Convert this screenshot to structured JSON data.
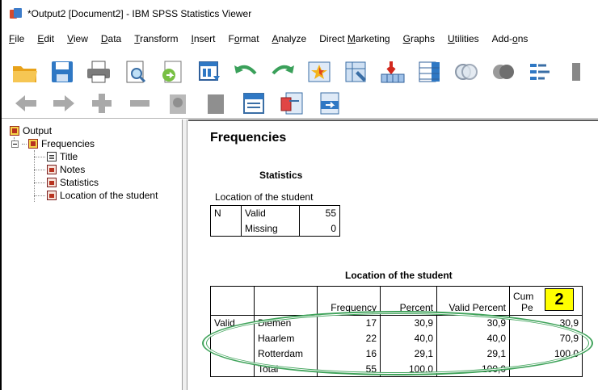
{
  "window": {
    "title": "*Output2 [Document2] - IBM SPSS Statistics Viewer"
  },
  "menu": [
    {
      "label": "File",
      "key": "F"
    },
    {
      "label": "Edit",
      "key": "E"
    },
    {
      "label": "View",
      "key": "V"
    },
    {
      "label": "Data",
      "key": "D"
    },
    {
      "label": "Transform",
      "key": "T"
    },
    {
      "label": "Insert",
      "key": "I"
    },
    {
      "label": "Format",
      "key": "o"
    },
    {
      "label": "Analyze",
      "key": "A"
    },
    {
      "label": "Direct Marketing",
      "key": "M"
    },
    {
      "label": "Graphs",
      "key": "G"
    },
    {
      "label": "Utilities",
      "key": "U"
    },
    {
      "label": "Add-ons",
      "key": "o"
    }
  ],
  "tree": {
    "root": "Output",
    "group": "Frequencies",
    "items": [
      "Title",
      "Notes",
      "Statistics",
      "Location of the student"
    ]
  },
  "output": {
    "heading": "Frequencies",
    "statistics": {
      "title": "Statistics",
      "variable": "Location of the student",
      "n_label": "N",
      "rows": [
        {
          "label": "Valid",
          "value": "55"
        },
        {
          "label": "Missing",
          "value": "0"
        }
      ]
    },
    "frequency": {
      "title": "Location of the student",
      "headers": {
        "frequency": "Frequency",
        "percent": "Percent",
        "valid_percent": "Valid Percent",
        "cumulative_line1": "Cum",
        "cumulative_line2": "Pe"
      },
      "valid_label": "Valid",
      "rows": [
        {
          "name": "Diemen",
          "frequency": "17",
          "percent": "30,9",
          "valid_percent": "30,9",
          "cumulative": "30,9"
        },
        {
          "name": "Haarlem",
          "frequency": "22",
          "percent": "40,0",
          "valid_percent": "40,0",
          "cumulative": "70,9"
        },
        {
          "name": "Rotterdam",
          "frequency": "16",
          "percent": "29,1",
          "valid_percent": "29,1",
          "cumulative": "100,0"
        },
        {
          "name": "Total",
          "frequency": "55",
          "percent": "100,0",
          "valid_percent": "100,0",
          "cumulative": ""
        }
      ]
    }
  },
  "annotation": {
    "badge": "2",
    "color": "#3fa35a",
    "badge_color": "#ffff00"
  },
  "icons": {
    "toolbar1": [
      "open-folder-icon",
      "save-icon",
      "print-icon",
      "print-preview-icon",
      "export-icon",
      "recall-dialog-icon",
      "undo-icon",
      "redo-icon",
      "goto-data-icon",
      "goto-variable-icon",
      "variables-icon",
      "chart-builder-icon",
      "select-cases-icon",
      "weight-cases-icon",
      "split-file-icon",
      "more-icon"
    ],
    "toolbar2": [
      "back-icon",
      "forward-icon",
      "expand-icon",
      "collapse-icon",
      "show-icon",
      "hide-icon",
      "insert-heading-icon",
      "insert-title-icon",
      "insert-text-icon"
    ]
  }
}
